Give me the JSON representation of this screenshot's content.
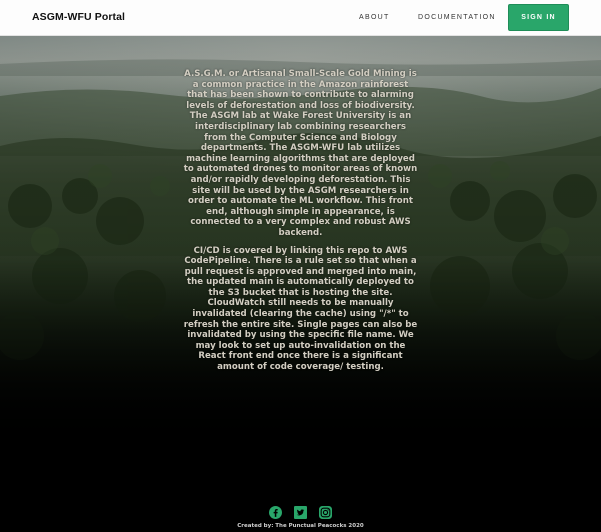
{
  "navbar": {
    "brand": "ASGM-WFU Portal",
    "links": [
      {
        "label": "ABOUT"
      },
      {
        "label": "DOCUMENTATION"
      }
    ],
    "signin_label": "SIGN IN",
    "accent": "#29a66a"
  },
  "main": {
    "paragraphs": [
      "A.S.G.M. or Artisanal Small-Scale Gold Mining is a common practice in the Amazon rainforest that has been shown to contribute to alarming levels of deforestation and loss of biodiversity. The ASGM lab at Wake Forest University is an interdisciplinary lab combining researchers from the Computer Science and Biology departments. The ASGM-WFU lab utilizes machine learning algorithms that are deployed to automated drones to monitor areas of known and/or rapidly developing deforestation. This site will be used by the ASGM researchers in order to automate the ML workflow. This front end, although simple in appearance, is connected to a very complex and robust AWS backend.",
      "CI/CD is covered by linking this repo to AWS CodePipeline. There is a rule set so that when a pull request is approved and merged into main, the updated main is automatically deployed to the S3 bucket that is hosting the site. CloudWatch still needs to be manually invalidated (clearing the cache) using \"/*\" to refresh the entire site. Single pages can also be invalidated by using the specific file name. We may look to set up auto-invalidation on the React front end once there is a significant amount of code coverage/ testing."
    ]
  },
  "footer": {
    "icons": [
      "facebook-icon",
      "twitter-icon",
      "instagram-icon"
    ],
    "icon_color": "#29a66a",
    "credit": "Created by: The Punctual Peacocks 2020"
  }
}
